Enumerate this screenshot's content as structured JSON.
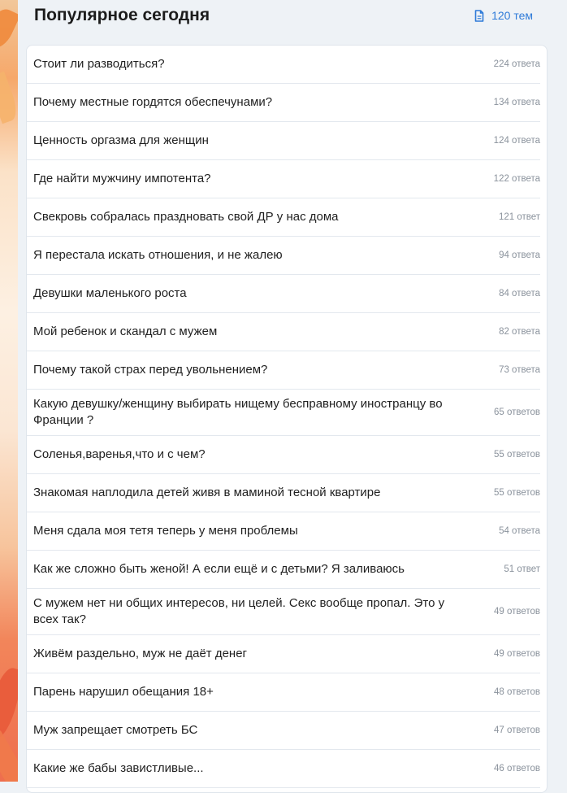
{
  "header": {
    "title": "Популярное сегодня",
    "topics_count": "120 тем",
    "topics_icon": "document-icon",
    "accent_color": "#2f7bd8"
  },
  "topics": [
    {
      "title": "Стоит ли разводиться?",
      "replies": "224 ответа"
    },
    {
      "title": "Почему местные гордятся обеспечунами?",
      "replies": "134 ответа"
    },
    {
      "title": "Ценность оргазма для женщин",
      "replies": "124 ответа"
    },
    {
      "title": "Где найти мужчину импотента?",
      "replies": "122 ответа"
    },
    {
      "title": "Свекровь собралась праздновать свой ДР у нас дома",
      "replies": "121 ответ"
    },
    {
      "title": "Я перестала искать отношения, и не жалею",
      "replies": "94 ответа"
    },
    {
      "title": "Девушки маленького роста",
      "replies": "84 ответа"
    },
    {
      "title": "Мой ребенок и скандал с мужем",
      "replies": "82 ответа"
    },
    {
      "title": "Почему такой страх перед увольнением?",
      "replies": "73 ответа"
    },
    {
      "title": "Какую девушку/женщину выбирать нищему бесправному иностранцу во Франции ?",
      "replies": "65 ответов"
    },
    {
      "title": "Соленья,варенья,что и с чем?",
      "replies": "55 ответов"
    },
    {
      "title": "Знакомая наплодила детей живя в маминой тесной квартире",
      "replies": "55 ответов"
    },
    {
      "title": "Меня сдала моя тетя теперь у меня проблемы",
      "replies": "54 ответа"
    },
    {
      "title": "Как же сложно быть женой! А если ещё и с детьми? Я заливаюсь",
      "replies": "51 ответ"
    },
    {
      "title": "С мужем нет ни общих интересов, ни целей. Секс вообще пропал. Это у всех так?",
      "replies": "49 ответов"
    },
    {
      "title": "Живём раздельно, муж не даёт денег",
      "replies": "49 ответов"
    },
    {
      "title": "Парень нарушил обещания 18+",
      "replies": "48 ответов"
    },
    {
      "title": "Муж запрещает смотреть БС",
      "replies": "47 ответов"
    },
    {
      "title": "Какие же бабы завистливые...",
      "replies": "46 ответов"
    }
  ]
}
